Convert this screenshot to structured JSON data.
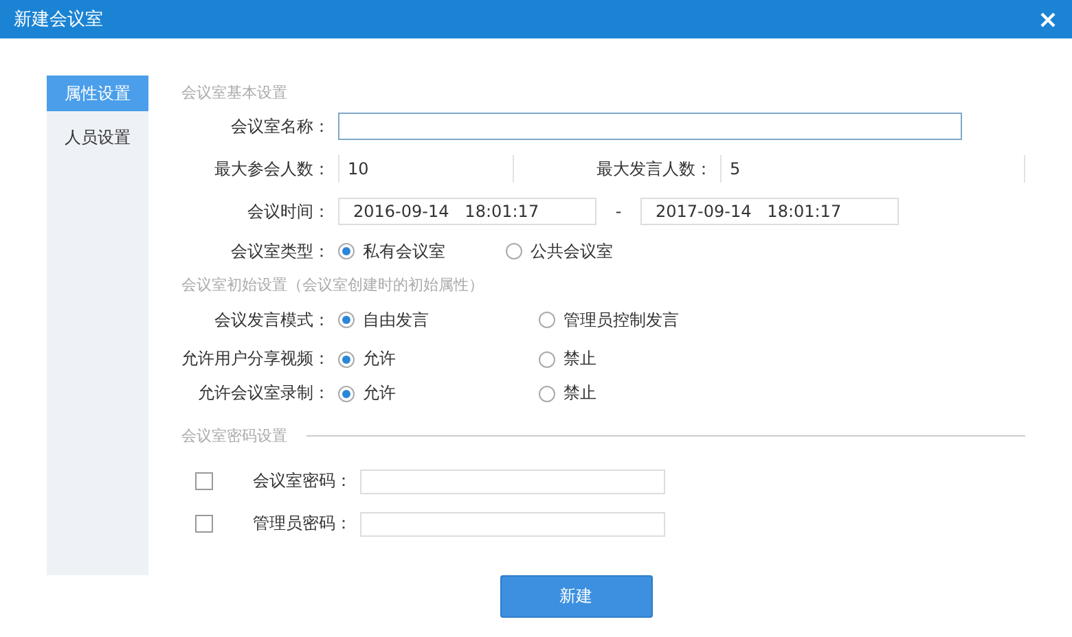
{
  "window": {
    "title": "新建会议室"
  },
  "sidebar": {
    "items": [
      {
        "label": "属性设置",
        "selected": true
      },
      {
        "label": "人员设置",
        "selected": false
      }
    ]
  },
  "basic": {
    "title": "会议室基本设置",
    "name": {
      "label": "会议室名称："
    },
    "counts": [
      {
        "label": "最大参会人数：",
        "value": "10"
      },
      {
        "label": "最大发言人数：",
        "value": "5"
      }
    ],
    "time": {
      "label": "会议时间：",
      "start": "2016-09-14   18:01:17",
      "separator": "-",
      "end": "2017-09-14   18:01:17"
    },
    "room_type": {
      "label": "会议室类型：",
      "options": [
        {
          "label": "私有会议室",
          "selected": true
        },
        {
          "label": "公共会议室",
          "selected": false
        }
      ]
    }
  },
  "initial": {
    "title": "会议室初始设置（会议室创建时的初始属性）",
    "rows": [
      {
        "label": "会议发言模式：",
        "options": [
          {
            "label": "自由发言",
            "selected": true
          },
          {
            "label": "管理员控制发言",
            "selected": false
          }
        ]
      },
      {
        "label": "允许用户分享视频：",
        "options": [
          {
            "label": "允许",
            "selected": true
          },
          {
            "label": "禁止",
            "selected": false
          }
        ]
      },
      {
        "label": "允许会议室录制：",
        "options": [
          {
            "label": "允许",
            "selected": true
          },
          {
            "label": "禁止",
            "selected": false
          }
        ]
      }
    ]
  },
  "password": {
    "title": "会议室密码设置",
    "rows": [
      {
        "label": "会议室密码：",
        "checked": false
      },
      {
        "label": "管理员密码：",
        "checked": false
      }
    ]
  },
  "button": "新建"
}
